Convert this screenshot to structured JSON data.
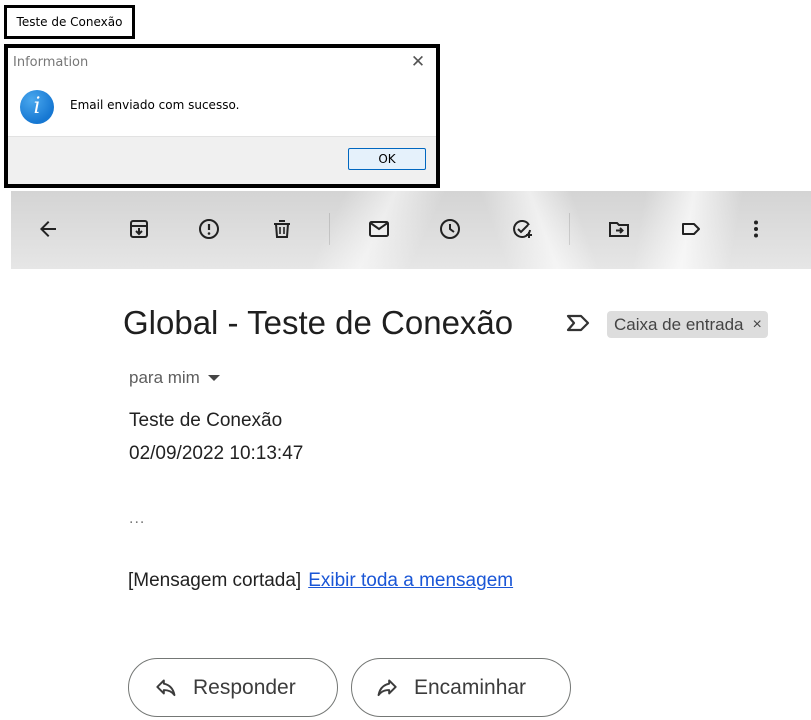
{
  "connection_window": {
    "title": "Teste de Conexão"
  },
  "dialog": {
    "title": "Information",
    "message": "Email enviado com sucesso.",
    "ok_label": "OK",
    "close_glyph": "✕",
    "icon": "info-icon"
  },
  "toolbar": {
    "buttons": [
      {
        "name": "back",
        "icon": "arrow-back-icon"
      },
      {
        "name": "archive",
        "icon": "archive-icon"
      },
      {
        "name": "report-spam",
        "icon": "report-icon"
      },
      {
        "name": "delete",
        "icon": "trash-icon"
      },
      {
        "name": "mark-unread",
        "icon": "mail-icon"
      },
      {
        "name": "snooze",
        "icon": "clock-icon"
      },
      {
        "name": "add-to-tasks",
        "icon": "add-task-icon"
      },
      {
        "name": "move-to",
        "icon": "folder-move-icon"
      },
      {
        "name": "labels",
        "icon": "label-icon"
      },
      {
        "name": "more",
        "icon": "more-vert-icon"
      }
    ]
  },
  "email": {
    "subject": "Global - Teste de Conexão",
    "label": "Caixa de entrada",
    "label_remove": "×",
    "recipient": "para mim",
    "body_lines": [
      "Teste de Conexão",
      "02/09/2022 10:13:47"
    ],
    "ellipsis": "...",
    "trimmed_text": "[Mensagem cortada]",
    "view_full_link": "Exibir toda a mensagem",
    "reply_label": "Responder",
    "forward_label": "Encaminhar"
  },
  "colors": {
    "link": "#1a56d6",
    "info_blue": "#1677d2",
    "chip_bg": "#dddddd"
  }
}
